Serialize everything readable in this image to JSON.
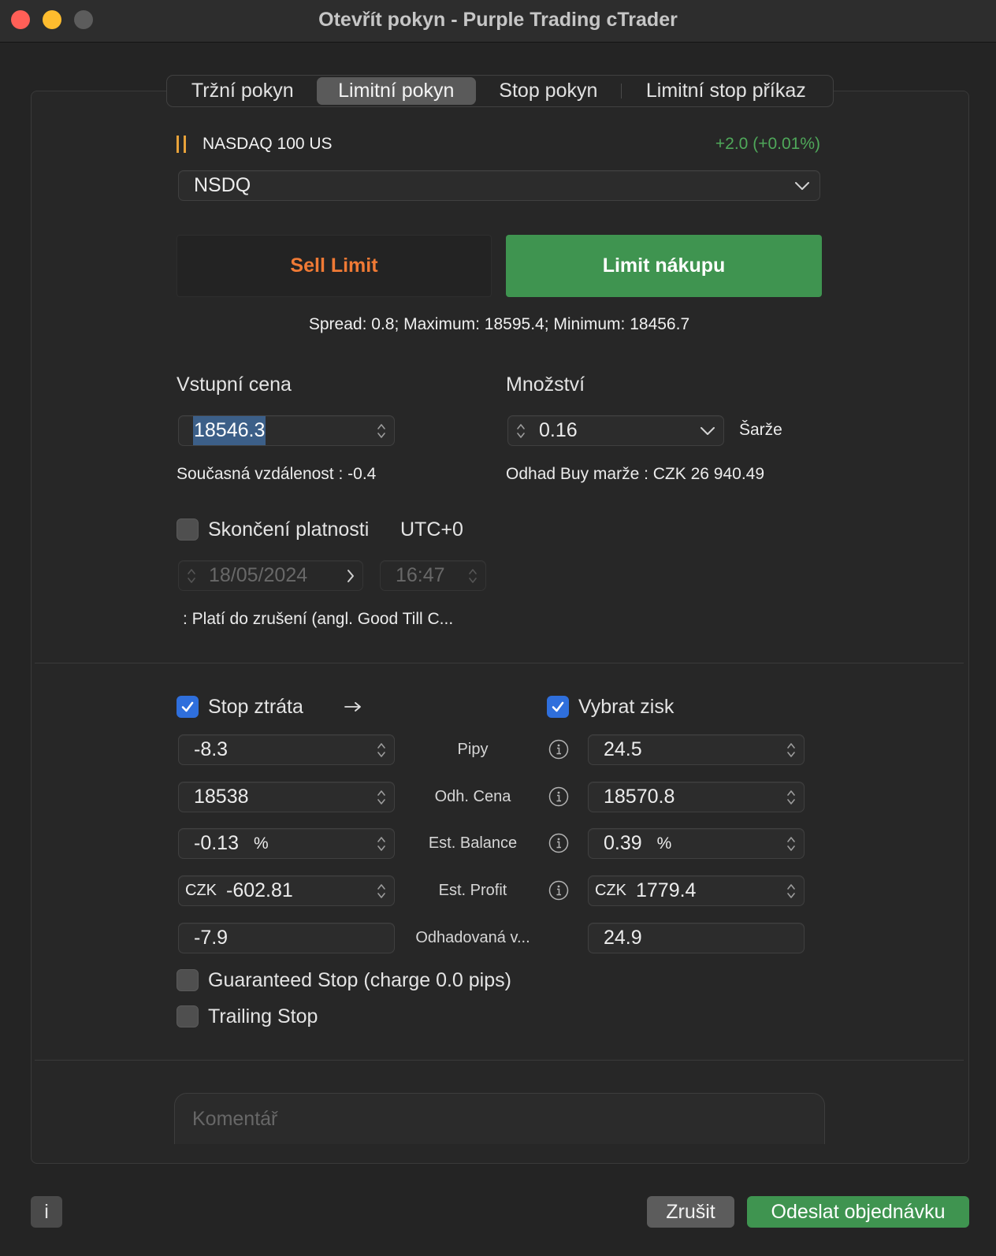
{
  "window": {
    "title": "Otevřít pokyn - Purple Trading cTrader"
  },
  "colors": {
    "accent_green": "#3f9450",
    "sell_orange": "#f07a35",
    "positive_change": "#4fa85a",
    "checkbox_blue": "#2f6fdc",
    "market_status_orange": "#e8a23a",
    "window_close": "#ff5f57",
    "window_minimize": "#febc2e",
    "window_zoom_disabled": "#5c5c5c"
  },
  "order_types": {
    "selected_index": 1,
    "tabs": [
      {
        "label": "Tržní pokyn"
      },
      {
        "label": "Limitní pokyn"
      },
      {
        "label": "Stop pokyn"
      },
      {
        "label": "Limitní stop příkaz"
      }
    ]
  },
  "symbol": {
    "name": "NASDAQ 100 US",
    "change": "+2.0 (+0.01%)",
    "selected": "NSDQ"
  },
  "direction": {
    "sell_label": "Sell Limit",
    "buy_label": "Limit nákupu",
    "selected": "buy"
  },
  "spread_info": "Spread: 0.8; Maximum: 18595.4; Minimum: 18456.7",
  "entry_price": {
    "label": "Vstupní cena",
    "value": "18546.3",
    "distance_label": "Současná vzdálenost :",
    "distance_value": "-0.4"
  },
  "quantity": {
    "label": "Množství",
    "value": "0.16",
    "unit": "Šarže",
    "margin_label": "Odhad Buy marže :",
    "margin_value": "CZK 26 940.49"
  },
  "expiry": {
    "label": "Skončení platnosti",
    "checked": false,
    "timezone": "UTC+0",
    "date": "18/05/2024",
    "time": "16:47",
    "note": ": Platí do zrušení (angl. Good Till C..."
  },
  "protection": {
    "stop_loss": {
      "label": "Stop ztráta",
      "checked": true
    },
    "take_profit": {
      "label": "Vybrat zisk",
      "checked": true
    },
    "rows": [
      {
        "label": "Pipy",
        "sl": "-8.3",
        "tp": "24.5"
      },
      {
        "label": "Odh. Cena",
        "sl": "18538",
        "tp": "18570.8"
      },
      {
        "label": "Est. Balance",
        "sl": "-0.13",
        "tp": "0.39",
        "suffix": "%"
      },
      {
        "label": "Est. Profit",
        "prefix": "CZK",
        "sl": "-602.81",
        "tp": "1779.4"
      },
      {
        "label": "Odhadovaná v...",
        "sl": "-7.9",
        "tp": "24.9"
      }
    ],
    "guaranteed_stop": {
      "label": "Guaranteed Stop (charge 0.0 pips)",
      "checked": false
    },
    "trailing_stop": {
      "label": "Trailing Stop",
      "checked": false
    }
  },
  "comment": {
    "placeholder": "Komentář"
  },
  "footer": {
    "info_label": "i",
    "cancel_label": "Zrušit",
    "submit_label": "Odeslat objednávku"
  }
}
